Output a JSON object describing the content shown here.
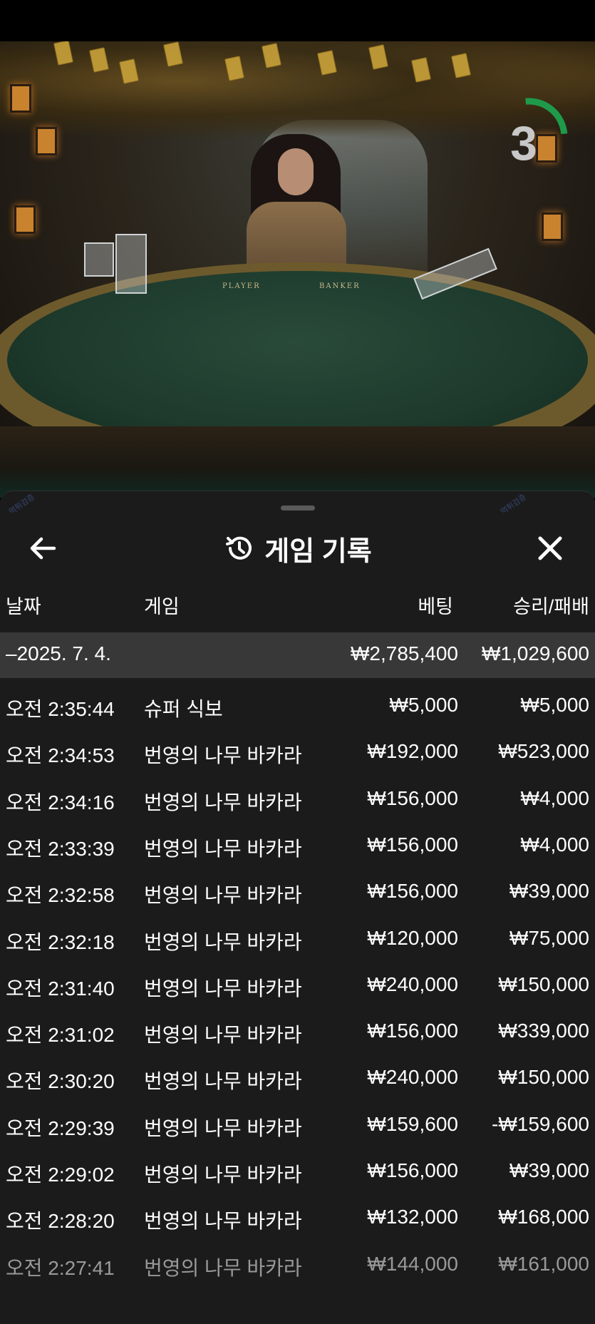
{
  "game_overlay": {
    "timer_value": "3",
    "timer_progress": 0.25,
    "felt_player_label": "PLAYER",
    "felt_banker_label": "BANKER"
  },
  "panel": {
    "title": "게임 기록",
    "icons": {
      "back": "arrow-left-icon",
      "history": "history-icon",
      "close": "close-icon"
    },
    "columns": {
      "date": "날짜",
      "game": "게임",
      "bet": "베팅",
      "win_loss": "승리/패배"
    },
    "summary": {
      "date": "–2025. 7. 4.",
      "bet": "₩2,785,400",
      "win_loss": "₩1,029,600"
    },
    "rows": [
      {
        "time": "오전 2:35:44",
        "game": "슈퍼 식보",
        "bet": "₩5,000",
        "result": "₩5,000"
      },
      {
        "time": "오전 2:34:53",
        "game": "번영의 나무 바카라",
        "bet": "₩192,000",
        "result": "₩523,000"
      },
      {
        "time": "오전 2:34:16",
        "game": "번영의 나무 바카라",
        "bet": "₩156,000",
        "result": "₩4,000"
      },
      {
        "time": "오전 2:33:39",
        "game": "번영의 나무 바카라",
        "bet": "₩156,000",
        "result": "₩4,000"
      },
      {
        "time": "오전 2:32:58",
        "game": "번영의 나무 바카라",
        "bet": "₩156,000",
        "result": "₩39,000"
      },
      {
        "time": "오전 2:32:18",
        "game": "번영의 나무 바카라",
        "bet": "₩120,000",
        "result": "₩75,000"
      },
      {
        "time": "오전 2:31:40",
        "game": "번영의 나무 바카라",
        "bet": "₩240,000",
        "result": "₩150,000"
      },
      {
        "time": "오전 2:31:02",
        "game": "번영의 나무 바카라",
        "bet": "₩156,000",
        "result": "₩339,000"
      },
      {
        "time": "오전 2:30:20",
        "game": "번영의 나무 바카라",
        "bet": "₩240,000",
        "result": "₩150,000"
      },
      {
        "time": "오전 2:29:39",
        "game": "번영의 나무 바카라",
        "bet": "₩159,600",
        "result": "-₩159,600"
      },
      {
        "time": "오전 2:29:02",
        "game": "번영의 나무 바카라",
        "bet": "₩156,000",
        "result": "₩39,000"
      },
      {
        "time": "오전 2:28:20",
        "game": "번영의 나무 바카라",
        "bet": "₩132,000",
        "result": "₩168,000"
      },
      {
        "time": "오전 2:27:41",
        "game": "번영의 나무 바카라",
        "bet": "₩144,000",
        "result": "₩161,000"
      }
    ]
  },
  "colors": {
    "panel_bg": "#1b1b1b",
    "summary_bg": "#383838",
    "timer_green": "#1f9a4a",
    "text": "#ffffff"
  }
}
